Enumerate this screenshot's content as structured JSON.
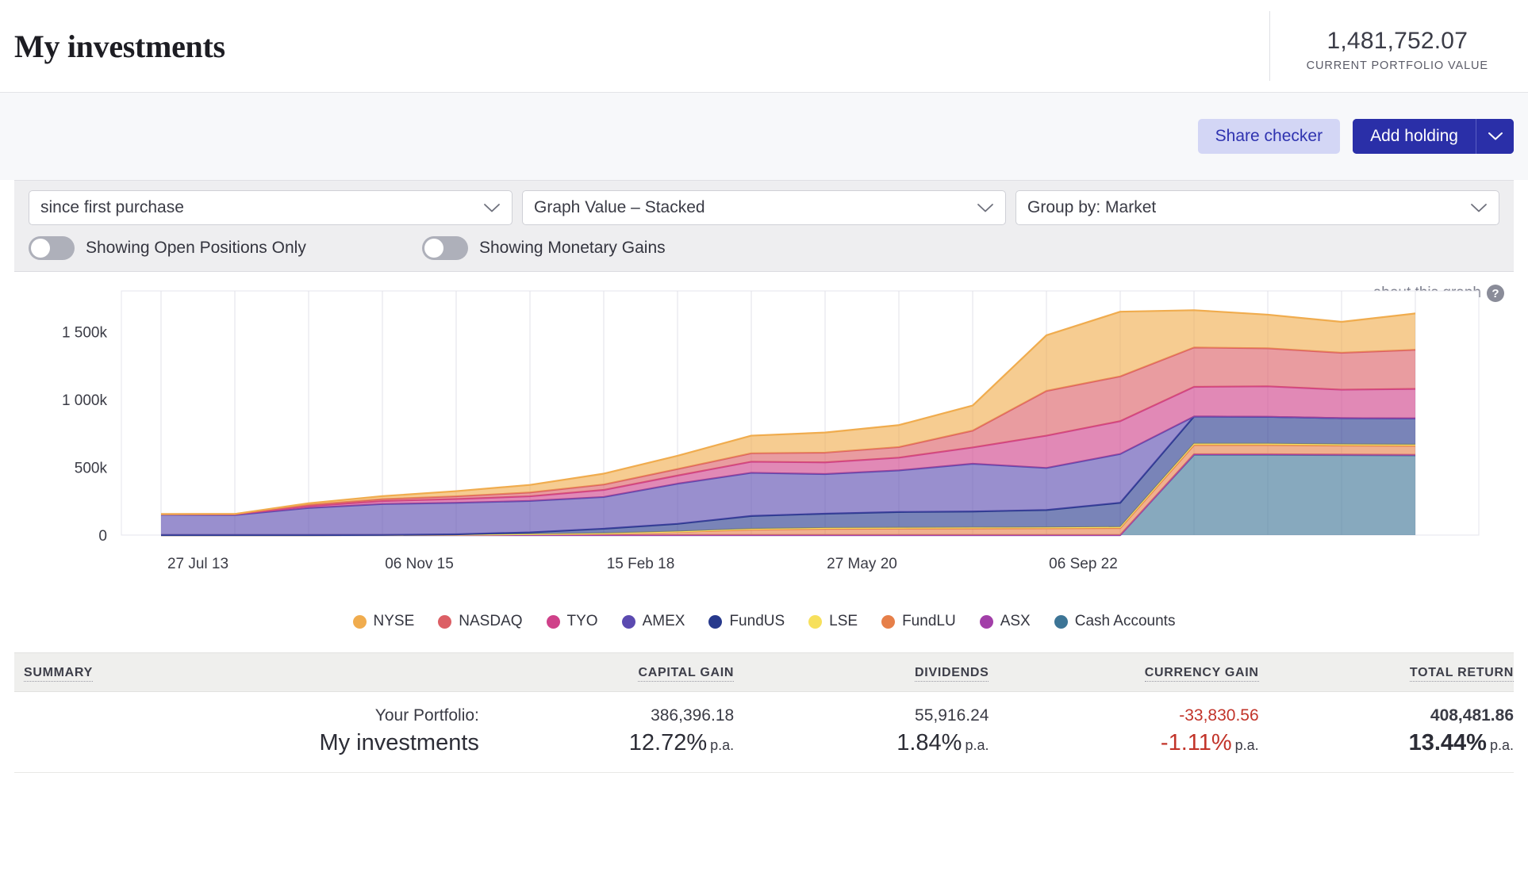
{
  "header": {
    "title": "My investments",
    "portfolio_value": "1,481,752.07",
    "portfolio_value_label": "CURRENT PORTFOLIO VALUE"
  },
  "toolbar": {
    "share_checker_label": "Share checker",
    "add_holding_label": "Add holding",
    "add_holding_caret_icon": "chevron-down-icon"
  },
  "filters": {
    "period_select": {
      "value": "since first purchase",
      "icon": "chevron-down-icon"
    },
    "graph_select": {
      "value": "Graph Value – Stacked",
      "icon": "chevron-down-icon"
    },
    "group_select": {
      "value": "Group by: Market",
      "icon": "chevron-down-icon"
    },
    "toggle_open_positions": {
      "label": "Showing Open Positions Only",
      "on": false
    },
    "toggle_monetary_gains": {
      "label": "Showing Monetary Gains",
      "on": false
    }
  },
  "chart_panel": {
    "about_link": "about this graph",
    "about_icon": "help-circle-icon"
  },
  "chart_data": {
    "type": "area",
    "stacked": true,
    "title": "",
    "xlabel": "",
    "ylabel": "",
    "ylim": [
      0,
      1800000
    ],
    "grid": "vertical",
    "legend_position": "bottom",
    "ytick_labels": [
      "0",
      "500k",
      "1 000k",
      "1 500k"
    ],
    "ytick_values": [
      0,
      500000,
      1000000,
      1500000
    ],
    "xtick_labels": [
      "27 Jul 13",
      "06 Nov 15",
      "15 Feb 18",
      "27 May 20",
      "06 Sep 22"
    ],
    "xtick_positions": [
      0.5,
      3.5,
      6.5,
      9.5,
      12.5
    ],
    "x": [
      0,
      1,
      2,
      3,
      4,
      5,
      6,
      7,
      8,
      9,
      10,
      11,
      12,
      13,
      14,
      15,
      16,
      17
    ],
    "series": [
      {
        "name": "Cash Accounts",
        "color": "#3d7596",
        "values": [
          0,
          0,
          0,
          0,
          0,
          0,
          0,
          0,
          0,
          0,
          0,
          0,
          0,
          0,
          592000,
          592000,
          590000,
          588000
        ]
      },
      {
        "name": "ASX",
        "color": "#a23fa8",
        "values": [
          0,
          0,
          0,
          0,
          0,
          0,
          0,
          0,
          0,
          0,
          0,
          0,
          0,
          0,
          4000,
          4000,
          4000,
          4000
        ]
      },
      {
        "name": "FundLU",
        "color": "#e67f49",
        "values": [
          0,
          0,
          0,
          1000,
          3000,
          7000,
          12000,
          24000,
          40000,
          46000,
          48000,
          49000,
          50000,
          52000,
          68000,
          68000,
          66000,
          66000
        ]
      },
      {
        "name": "LSE",
        "color": "#f7e05c",
        "values": [
          0,
          0,
          0,
          0,
          0,
          0,
          1000,
          3000,
          6000,
          7000,
          7000,
          7000,
          7000,
          8000,
          10000,
          10000,
          9000,
          9000
        ]
      },
      {
        "name": "FundUS",
        "color": "#27398c",
        "values": [
          0,
          0,
          0,
          0,
          3000,
          13000,
          34000,
          56000,
          95000,
          105000,
          115000,
          118000,
          128000,
          178000,
          200000,
          198000,
          193000,
          193000
        ]
      },
      {
        "name": "AMEX",
        "color": "#5b4ab0",
        "values": [
          150000,
          148000,
          200000,
          228000,
          232000,
          232000,
          234000,
          296000,
          318000,
          292000,
          307000,
          352000,
          310000,
          360000,
          0,
          0,
          0,
          0
        ]
      },
      {
        "name": "TYO",
        "color": "#cf4189",
        "values": [
          4000,
          5000,
          14000,
          22000,
          28000,
          34000,
          52000,
          60000,
          82000,
          86000,
          94000,
          120000,
          238000,
          242000,
          219000,
          225000,
          210000,
          218000
        ]
      },
      {
        "name": "NASDAQ",
        "color": "#dc5f65",
        "values": [
          1000,
          2000,
          9000,
          14000,
          20000,
          28000,
          40000,
          48000,
          62000,
          72000,
          78000,
          124000,
          330000,
          330000,
          290000,
          280000,
          272000,
          288000
        ]
      },
      {
        "name": "NYSE",
        "color": "#f0ac4e",
        "values": [
          0,
          1000,
          12000,
          22000,
          38000,
          56000,
          80000,
          98000,
          130000,
          148000,
          162000,
          185000,
          410000,
          477000,
          275000,
          248000,
          228000,
          268000
        ]
      }
    ],
    "legend": [
      {
        "label": "NYSE",
        "color": "#f0ac4e"
      },
      {
        "label": "NASDAQ",
        "color": "#dc5f65"
      },
      {
        "label": "TYO",
        "color": "#cf4189"
      },
      {
        "label": "AMEX",
        "color": "#5b4ab0"
      },
      {
        "label": "FundUS",
        "color": "#27398c"
      },
      {
        "label": "LSE",
        "color": "#f7e05c"
      },
      {
        "label": "FundLU",
        "color": "#e67f49"
      },
      {
        "label": "ASX",
        "color": "#a23fa8"
      },
      {
        "label": "Cash Accounts",
        "color": "#3d7596"
      }
    ]
  },
  "summary": {
    "columns": [
      "SUMMARY",
      "CAPITAL GAIN",
      "DIVIDENDS",
      "CURRENCY GAIN",
      "TOTAL RETURN"
    ],
    "row": {
      "label_top": "Your Portfolio:",
      "label_main": "My investments",
      "capital_gain_amount": "386,396.18",
      "capital_gain_pct": "12.72%",
      "capital_gain_pa": "p.a.",
      "dividends_amount": "55,916.24",
      "dividends_pct": "1.84%",
      "dividends_pa": "p.a.",
      "currency_gain_amount": "-33,830.56",
      "currency_gain_pct": "-1.11%",
      "currency_gain_pa": "p.a.",
      "total_return_amount": "408,481.86",
      "total_return_pct": "13.44%",
      "total_return_pa": "p.a."
    }
  }
}
